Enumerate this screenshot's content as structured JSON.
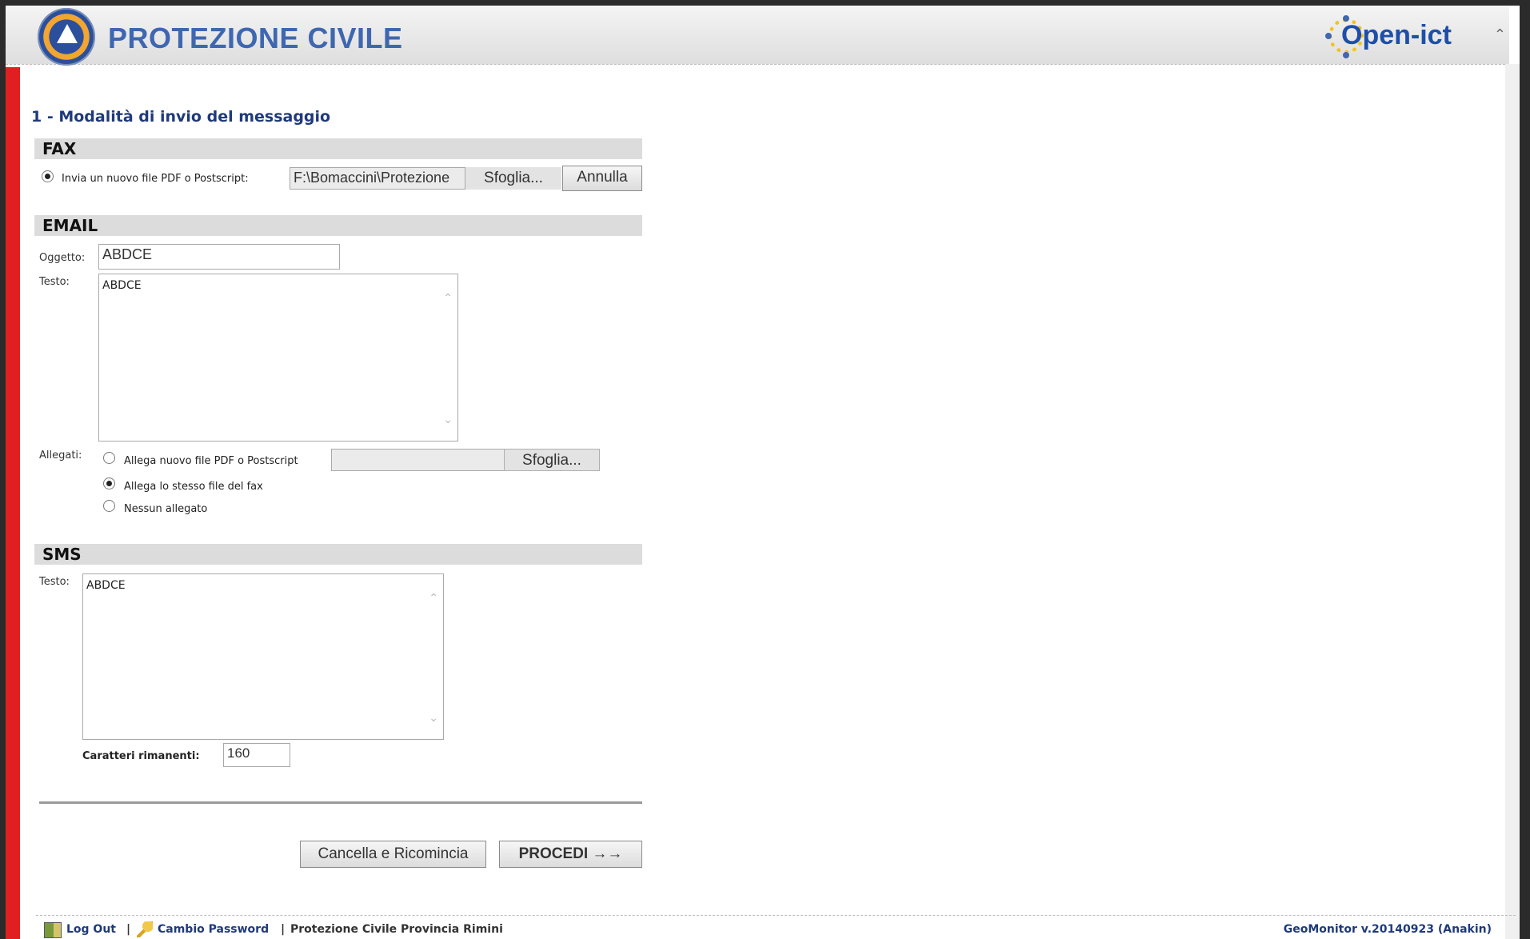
{
  "header": {
    "brand": "PROTEZIONE CIVILE",
    "partner_logo": "Open-ict"
  },
  "section_title": "1 - Modalità di invio del messaggio",
  "fax": {
    "title": "FAX",
    "radio_label": "Invia un nuovo file PDF o Postscript:",
    "file_value": "F:\\Bomaccini\\Protezione",
    "browse_label": "Sfoglia...",
    "cancel_label": "Annulla"
  },
  "email": {
    "title": "EMAIL",
    "subject_label": "Oggetto:",
    "subject_value": "ABDCE",
    "text_label": "Testo:",
    "text_value": "ABDCE",
    "attachments_label": "Allegati:",
    "attach_new_label": "Allega nuovo file PDF o Postscript",
    "attach_browse_label": "Sfoglia...",
    "attach_same_label": "Allega lo stesso file del fax",
    "attach_none_label": "Nessun allegato"
  },
  "sms": {
    "title": "SMS",
    "text_label": "Testo:",
    "text_value": "ABDCE",
    "remaining_label": "Caratteri rimanenti:",
    "remaining_value": "160"
  },
  "actions": {
    "reset_label": "Cancella e Ricomincia",
    "proceed_label": "PROCEDI →→"
  },
  "footer": {
    "logout": "Log Out",
    "change_password": "Cambio Password",
    "org": "Protezione Civile Provincia Rimini",
    "version": "GeoMonitor  v.20140923 (Anakin)",
    "sep1": "|",
    "sep2": "|"
  },
  "icons": {
    "logo": "protezione-civile-logo",
    "logout": "logout-icon",
    "key": "key-icon"
  },
  "colors": {
    "accent": "#1f3a7a",
    "brand": "#3f67b0",
    "sidebar": "#e02020"
  }
}
